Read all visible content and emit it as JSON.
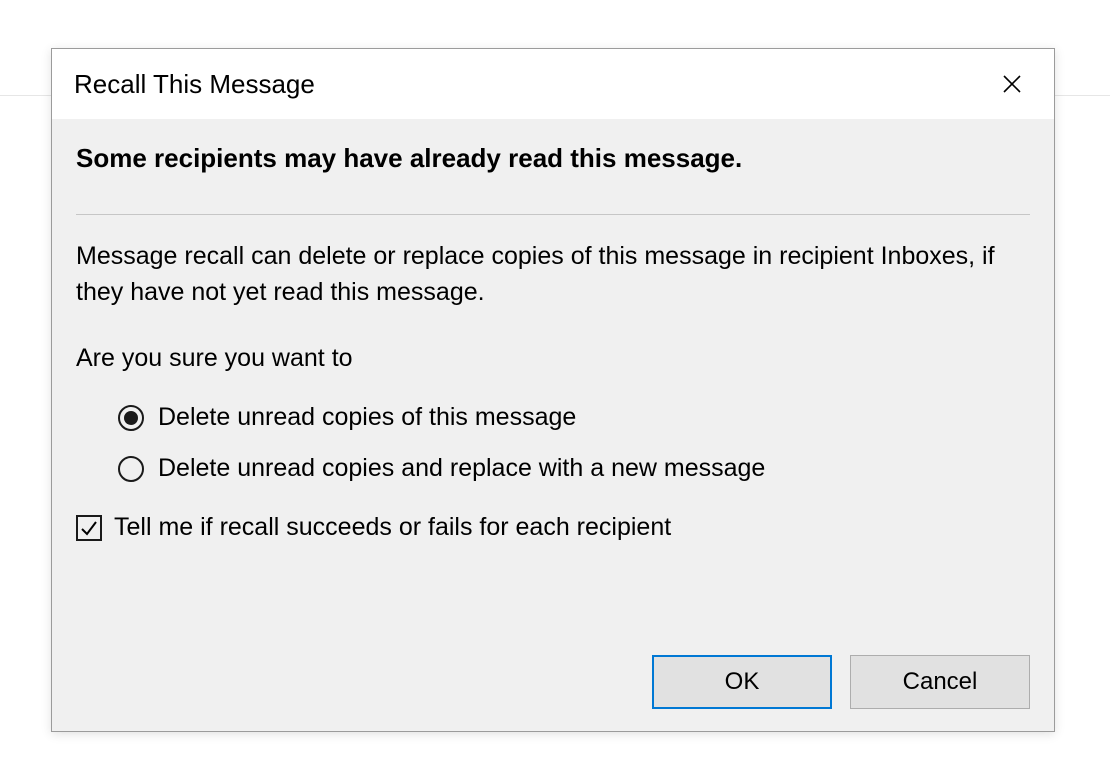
{
  "dialog": {
    "title": "Recall This Message",
    "headline": "Some recipients may have already read this message.",
    "explanation": "Message recall can delete or replace copies of this message in recipient Inboxes, if they have not yet read this message.",
    "prompt": "Are you sure you want to",
    "radios": {
      "selected": 0,
      "options": [
        "Delete unread copies of this message",
        "Delete unread copies and replace with a new message"
      ]
    },
    "checkbox": {
      "checked": true,
      "label": "Tell me if recall succeeds or fails for each recipient"
    },
    "buttons": {
      "ok": "OK",
      "cancel": "Cancel"
    }
  }
}
